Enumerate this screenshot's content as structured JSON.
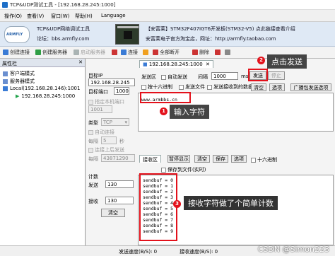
{
  "window": {
    "title": "TCP&UDP测试工具 - [192.168.28.245:1000]"
  },
  "menu": [
    "操作(O)",
    "查看(V)",
    "窗口(W)",
    "帮助(H)",
    "Language"
  ],
  "banner": {
    "logo": "ARMFLY",
    "line1": "TCP&UDP网络调试工具",
    "line2": "论坛：bbs.armfly.com",
    "line3": "【安富莱】STM32F407IGT6开发板(STM32-V5) 点此链接查看介绍",
    "line4": "安富莱电子官方淘宝店，网址：http://armfly.taobao.com"
  },
  "toolbar": {
    "items": [
      {
        "label": "创建连接",
        "color": "#3a7bd5",
        "disabled": false
      },
      {
        "label": "创建服务器",
        "color": "#2f9e44",
        "disabled": false
      },
      {
        "label": "启动服务器",
        "color": "#9aa",
        "disabled": true
      },
      {
        "label": "",
        "color": "#c33",
        "disabled": false
      },
      {
        "label": "连接",
        "color": "#3a7bd5",
        "disabled": false
      },
      {
        "label": "",
        "color": "#f0a020",
        "disabled": false
      },
      {
        "label": "全部断开",
        "color": "#c33",
        "disabled": false
      },
      {
        "label": "删除",
        "color": "#c33",
        "disabled": false
      },
      {
        "label": "",
        "color": "#c33",
        "disabled": false
      },
      {
        "label": "",
        "color": "#888",
        "disabled": false
      }
    ]
  },
  "left_panel": {
    "header": "属性栏",
    "tree": [
      "客户端模式",
      "服务器模式",
      "Local(192.168.28.146):1001",
      "192.168.28.245:1000"
    ]
  },
  "center_panel": {
    "target_ip_label": "目标IP",
    "target_ip_value": "192.168.28.245",
    "target_port_label": "目标端口",
    "target_port_value": "1000",
    "specify_local_port_label": "指定本机端口",
    "local_port_value": "1001",
    "type_label": "类型",
    "type_value": "TCP",
    "auto_connect_label": "自动连接",
    "auto_connect_interval_label": "每隔",
    "auto_connect_interval_value": "5",
    "auto_connect_unit": "秒",
    "reconnect_label": "连接上后发送",
    "reconnect_interval_label": "每隔",
    "reconnect_interval_value": "43871290",
    "count_label": "计数",
    "send_label": "发送",
    "send_count": "130",
    "recv_label": "接收",
    "recv_count": "130",
    "clear_button": "清空"
  },
  "right_panel": {
    "tab_title": "192.168.28.245:1000",
    "send_area_label": "发送区",
    "auto_send_label": "自动发送",
    "interval_label": "间隔",
    "interval_value": "1000",
    "interval_unit": "ms",
    "send_button": "发送",
    "stop_button": "停止",
    "hex_label": "按十六进制",
    "send_file_label": "发送文件",
    "send_recv_data_label": "发送接收到的数据",
    "clear_button": "清空",
    "options_button": "选项",
    "broadcast_button": "广播包发送选项",
    "send_text": "www.armbbs.cn",
    "recv_area_label": "接收区",
    "pause_display_button": "暂停显示",
    "recv_clear_button": "清空",
    "save_button": "保存",
    "recv_options_button": "选项",
    "recv_hex_label": "十六进制",
    "save_to_file_label": "保存到文件(实时)",
    "recv_lines": [
      "sendbuf = 0",
      "sendbuf = 1",
      "sendbuf = 2",
      "sendbuf = 3",
      "sendbuf = 4",
      "sendbuf = 5",
      "sendbuf = 6",
      "sendbuf = 7",
      "sendbuf = 8",
      "sendbuf = 9"
    ]
  },
  "status_bar": {
    "send_speed": "发送速度(B/S): 0",
    "recv_speed": "接收速度(B/S): 0"
  },
  "annotations": {
    "a1_number": "1",
    "a1_text": "输入字符",
    "a2_number": "2",
    "a2_text": "点击发送",
    "a3_number": "3",
    "a3_text": "接收字符做了个简单计数",
    "color": "#e3111b"
  },
  "watermark": "CSDN @Simon223"
}
